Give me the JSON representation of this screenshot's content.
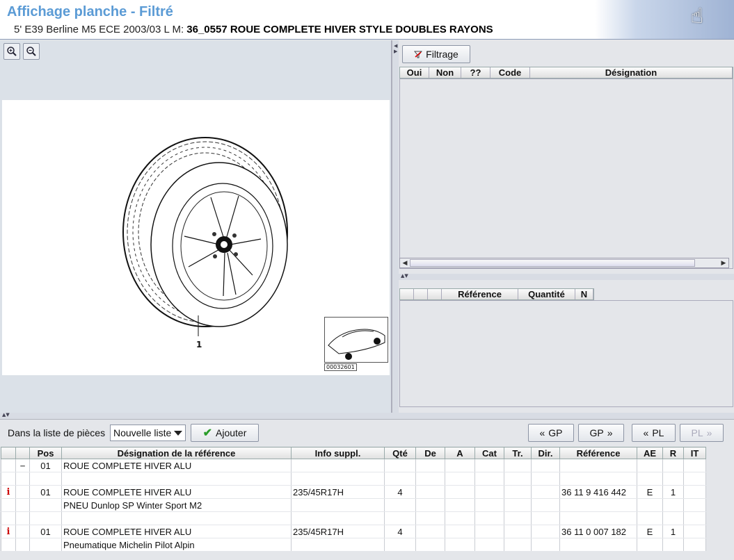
{
  "header": {
    "title": "Affichage planche - Filtré",
    "subtitle_prefix": "5' E39 Berline M5 ECE 2003/03 L M:",
    "subtitle_bold": "36_0557 ROUE COMPLETE HIVER STYLE DOUBLES RAYONS"
  },
  "drawing": {
    "position_label": "1",
    "thumbnail_caption": "00032601"
  },
  "filter": {
    "button_label": "Filtrage",
    "columns": [
      "Oui",
      "Non",
      "??",
      "Code",
      "Désignation"
    ]
  },
  "ref_grid": {
    "columns": [
      "",
      "",
      "",
      "Référence",
      "Quantité",
      "N"
    ]
  },
  "toolbar": {
    "list_label": "Dans la liste de pièces",
    "list_select": "Nouvelle liste",
    "add_button": "Ajouter",
    "gp_prev": "GP",
    "gp_next": "GP",
    "pl_prev": "PL",
    "pl_next": "PL"
  },
  "parts_table": {
    "columns": [
      "",
      "",
      "Pos",
      "Désignation de la référence",
      "Info suppl.",
      "Qté",
      "De",
      "A",
      "Cat",
      "Tr.",
      "Dir.",
      "Référence",
      "AE",
      "R",
      "IT"
    ],
    "rows": [
      [
        "",
        "−",
        "01",
        "ROUE COMPLETE HIVER ALU",
        "",
        "",
        "",
        "",
        "",
        "",
        "",
        "",
        "",
        "",
        ""
      ],
      [
        "",
        "",
        "",
        "",
        "",
        "",
        "",
        "",
        "",
        "",
        "",
        "",
        "",
        "",
        ""
      ],
      [
        "i",
        "",
        "01",
        "ROUE COMPLETE HIVER ALU",
        "235/45R17H",
        "4",
        "",
        "",
        "",
        "",
        "",
        "36 11 9 416 442",
        "E",
        "1",
        ""
      ],
      [
        "",
        "",
        "",
        "PNEU Dunlop SP Winter Sport M2",
        "",
        "",
        "",
        "",
        "",
        "",
        "",
        "",
        "",
        "",
        ""
      ],
      [
        "",
        "",
        "",
        "",
        "",
        "",
        "",
        "",
        "",
        "",
        "",
        "",
        "",
        "",
        ""
      ],
      [
        "i",
        "",
        "01",
        "ROUE COMPLETE HIVER ALU",
        "235/45R17H",
        "4",
        "",
        "",
        "",
        "",
        "",
        "36 11 0 007 182",
        "E",
        "1",
        ""
      ],
      [
        "",
        "",
        "",
        "Pneumatique Michelin Pilot Alpin",
        "",
        "",
        "",
        "",
        "",
        "",
        "",
        "",
        "",
        "",
        ""
      ]
    ]
  }
}
